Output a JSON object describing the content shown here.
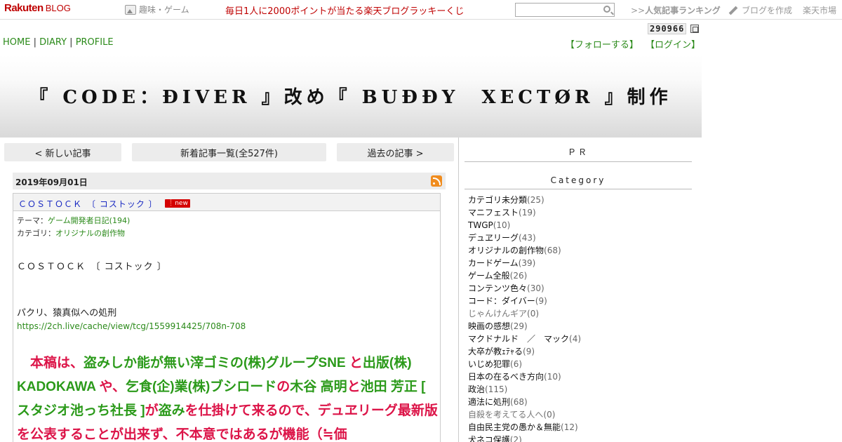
{
  "topbar": {
    "logo_main": "Rakuten",
    "logo_sub": "BLOG",
    "genre": "趣味・ゲーム",
    "lucky": "毎日1人に2000ポイントが当たる楽天ブログラッキーくじ",
    "search_placeholder": "",
    "ranking_prefix": ">>",
    "ranking_label": "人気記事ランキング",
    "create_label": "ブログを作成",
    "market_label": "楽天市場"
  },
  "header": {
    "counter": "290966",
    "nav": {
      "home": "HOME",
      "diary": "DIARY",
      "profile": "PROFILE",
      "sep": "|"
    },
    "follow": "【フォローする】",
    "login": "【ログイン】",
    "title": "『 CODE：ĐIVER 』改め『 BUĐĐY　XECTØR 』制作"
  },
  "pager": {
    "newer": "< 新しい記事",
    "list": "新着記事一覧(全527件)",
    "older": "過去の記事 >"
  },
  "entry": {
    "date": "2019年09月01日",
    "title": "ＣＯＳＴＯＣＫ　〔 コストック 〕",
    "badge": "new",
    "theme_label": "テーマ：",
    "theme_value": "ゲーム開発者日記(194)",
    "category_label": "カテゴリ：",
    "category_value": "オリジナルの創作物",
    "body_title": "ＣＯＳＴＯＣＫ　〔 コストック 〕",
    "body_line1": "パクリ、猿真似への処刑",
    "body_link": "https://2ch.live/cache/view/tcg/1559914425/708n-708",
    "big": [
      {
        "t": "　本稿は、",
        "c": "r"
      },
      {
        "t": "盗みしか能が無い滓ゴミの(株)グループSNE",
        "c": "g"
      },
      {
        "t": " と",
        "c": "r"
      },
      {
        "t": "出版(株) KADOKAWA",
        "c": "g"
      },
      {
        "t": " や、",
        "c": "r"
      },
      {
        "t": "乞食(企)業(株)ブシロード",
        "c": "g"
      },
      {
        "t": "の",
        "c": "r"
      },
      {
        "t": "木谷 高明",
        "c": "g"
      },
      {
        "t": "と",
        "c": "r"
      },
      {
        "t": "池田 芳正 [ スタジオ池っち社長 ]",
        "c": "g"
      },
      {
        "t": "が",
        "c": "r"
      },
      {
        "t": "盗み",
        "c": "g"
      },
      {
        "t": "を仕掛けて来るので、デュヱリーグ最新版を公表することが出来ず、不本意ではあるが機能（≒価",
        "c": "r"
      }
    ]
  },
  "sidebar": {
    "pr": "ＰＲ",
    "category_head": "Category",
    "categories": [
      {
        "name": "カテゴリ未分類",
        "count": "(25)"
      },
      {
        "name": "マニフェスト",
        "count": "(19)"
      },
      {
        "name": "TWGP",
        "count": "(10)"
      },
      {
        "name": "デュヱリーグ",
        "count": "(43)"
      },
      {
        "name": "オリジナルの創作物",
        "count": "(68)"
      },
      {
        "name": "カードゲーム",
        "count": "(39)"
      },
      {
        "name": "ゲーム全般",
        "count": "(26)"
      },
      {
        "name": "コンテンツ色々",
        "count": "(30)"
      },
      {
        "name": "コード：ダイバー",
        "count": "(9)"
      },
      {
        "name": "じゃんけんギア",
        "count": "(0)",
        "dim": true
      },
      {
        "name": "映画の感想",
        "count": "(29)"
      },
      {
        "name": "マクドナルド　／　マック",
        "count": "(4)"
      },
      {
        "name": "大卒が教ｪﾃｬる",
        "count": "(9)"
      },
      {
        "name": "いじめ犯罪",
        "count": "(6)"
      },
      {
        "name": "日本の在るべき方向",
        "count": "(10)"
      },
      {
        "name": "政治",
        "count": "(115)"
      },
      {
        "name": "適法に処刑",
        "count": "(68)"
      },
      {
        "name": "自殺を考えてる人へ",
        "count": "(0)",
        "dim": true
      },
      {
        "name": "自由民主党の愚か＆無能",
        "count": "(12)"
      },
      {
        "name": "犬ネコ保護",
        "count": "(2)"
      }
    ]
  }
}
